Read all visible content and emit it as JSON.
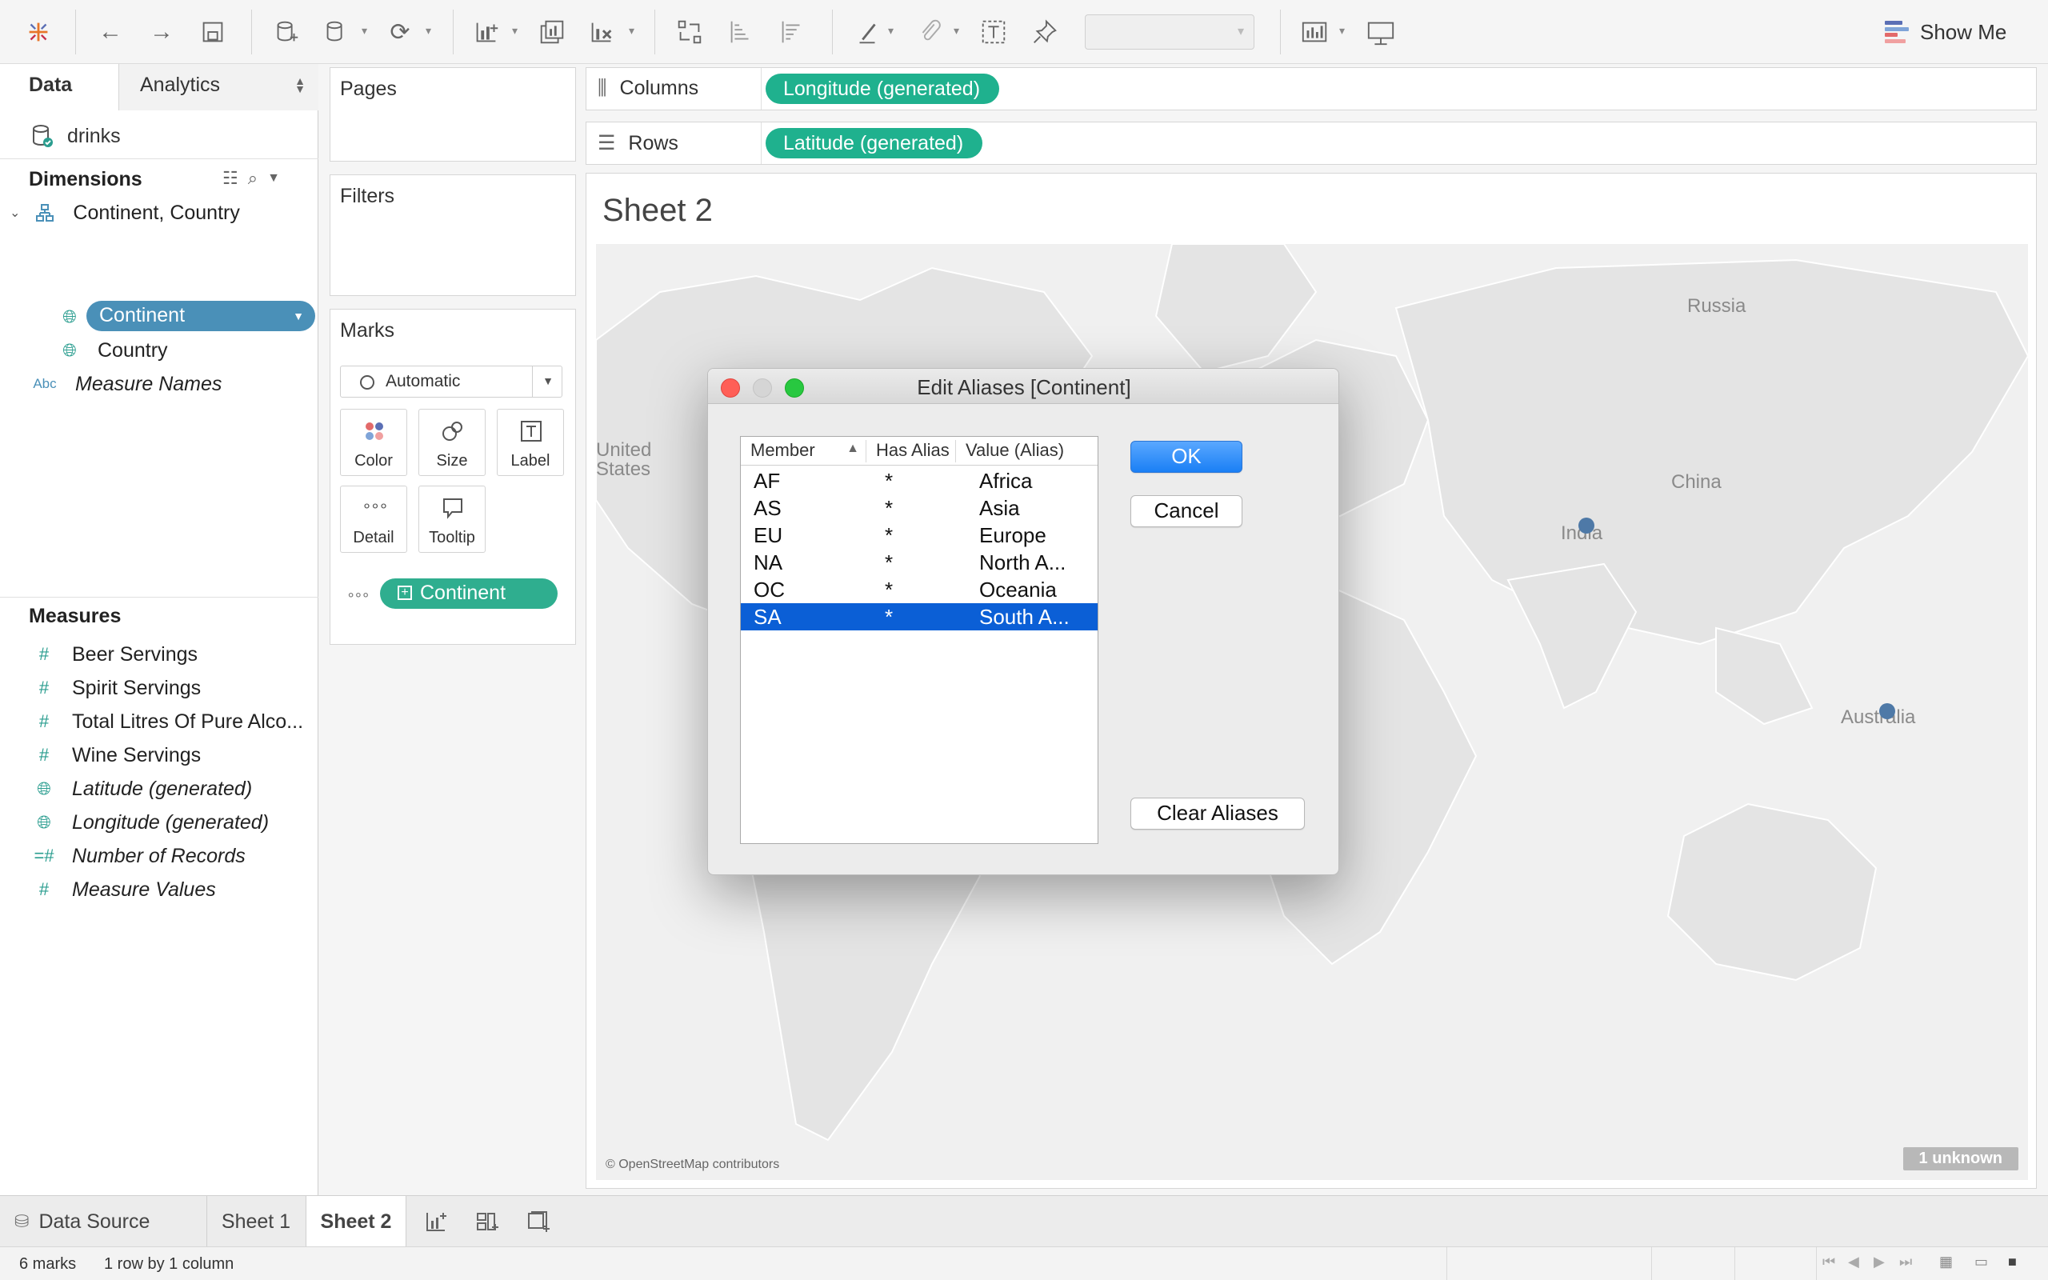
{
  "toolbar": {
    "show_me_label": "Show Me",
    "icons": [
      "tableau-logo-icon",
      "undo-icon",
      "redo-icon",
      "save-icon",
      "new-datasource-icon",
      "datasource-icon",
      "refresh-icon",
      "new-worksheet-icon",
      "duplicate-sheet-icon",
      "clear-sheet-icon",
      "swap-icon",
      "sort-ascending-icon",
      "sort-descending-icon",
      "highlight-icon",
      "group-icon",
      "label-icon",
      "pin-icon",
      "fit-icon",
      "presentation-icon"
    ]
  },
  "data_pane": {
    "tabs": {
      "data": "Data",
      "analytics": "Analytics"
    },
    "datasource": "drinks",
    "dimensions_title": "Dimensions",
    "dimensions": {
      "hierarchy": "Continent, Country",
      "continent": "Continent",
      "country": "Country",
      "measure_names": "Measure Names",
      "measure_names_type": "Abc"
    },
    "measures_title": "Measures",
    "measures": [
      "Beer Servings",
      "Spirit Servings",
      "Total Litres Of Pure Alco...",
      "Wine Servings",
      "Latitude (generated)",
      "Longitude (generated)",
      "Number of Records",
      "Measure Values"
    ]
  },
  "cards": {
    "pages": "Pages",
    "filters": "Filters",
    "marks": "Marks",
    "marks_type": "Automatic",
    "mark_buttons": {
      "color": "Color",
      "size": "Size",
      "label": "Label",
      "detail": "Detail",
      "tooltip": "Tooltip"
    },
    "detail_pill": "Continent"
  },
  "shelves": {
    "columns_label": "Columns",
    "columns_pill": "Longitude (generated)",
    "rows_label": "Rows",
    "rows_pill": "Latitude (generated)"
  },
  "view": {
    "sheet_title": "Sheet 2",
    "map_labels": {
      "russia": "Russia",
      "us_line1": "United",
      "us_line2": "States",
      "china": "China",
      "india": "India",
      "australia": "Australia"
    },
    "credit": "© OpenStreetMap contributors",
    "unknown_badge": "1 unknown",
    "point_color": "#4e79a7"
  },
  "dialog": {
    "title": "Edit Aliases [Continent]",
    "columns": {
      "member": "Member",
      "has_alias": "Has Alias",
      "value": "Value (Alias)"
    },
    "sort_indicator": "▲",
    "rows": [
      {
        "member": "AF",
        "has_alias": "*",
        "value": "Africa"
      },
      {
        "member": "AS",
        "has_alias": "*",
        "value": "Asia"
      },
      {
        "member": "EU",
        "has_alias": "*",
        "value": "Europe"
      },
      {
        "member": "NA",
        "has_alias": "*",
        "value": "North A..."
      },
      {
        "member": "OC",
        "has_alias": "*",
        "value": "Oceania"
      },
      {
        "member": "SA",
        "has_alias": "*",
        "value": "South A..."
      }
    ],
    "selected_member": "SA",
    "ok": "OK",
    "cancel": "Cancel",
    "clear_aliases": "Clear Aliases"
  },
  "sheet_tabs": {
    "data_source": "Data Source",
    "sheet1": "Sheet 1",
    "sheet2": "Sheet 2",
    "active": "Sheet 2"
  },
  "status": {
    "marks": "6 marks",
    "dims": "1 row by 1 column"
  },
  "colors": {
    "accent_green": "#1fb18e",
    "dim_pill": "#4a90b8",
    "selection": "#0b5fd6",
    "map_bg": "#f0f0f0"
  }
}
